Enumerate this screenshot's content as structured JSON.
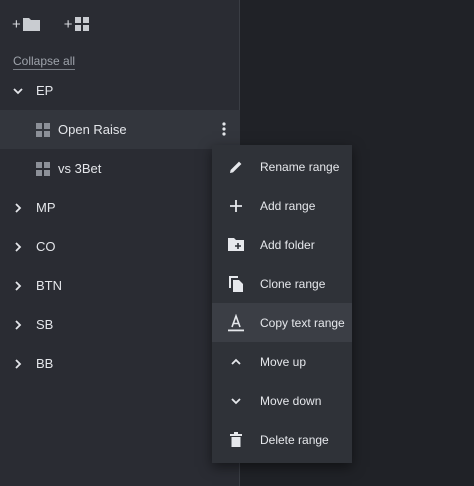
{
  "toolbar": {
    "add_folder_icon": "folder-plus-icon",
    "add_range_icon": "grid-plus-icon",
    "plus": "+"
  },
  "collapse_all": "Collapse all",
  "tree": {
    "ep": "EP",
    "open_raise": "Open Raise",
    "vs_3bet": "vs 3Bet",
    "mp": "MP",
    "co": "CO",
    "btn": "BTN",
    "sb": "SB",
    "bb": "BB"
  },
  "menu": {
    "rename_range": "Rename range",
    "add_range": "Add range",
    "add_folder": "Add folder",
    "clone_range": "Clone range",
    "copy_text_range": "Copy text range",
    "move_up": "Move up",
    "move_down": "Move down",
    "delete_range": "Delete range"
  },
  "colors": {
    "sidebar_bg": "#2a2c33",
    "menu_bg": "#2f3238",
    "selected_bg": "#33363d",
    "text": "#e4e6ea"
  }
}
